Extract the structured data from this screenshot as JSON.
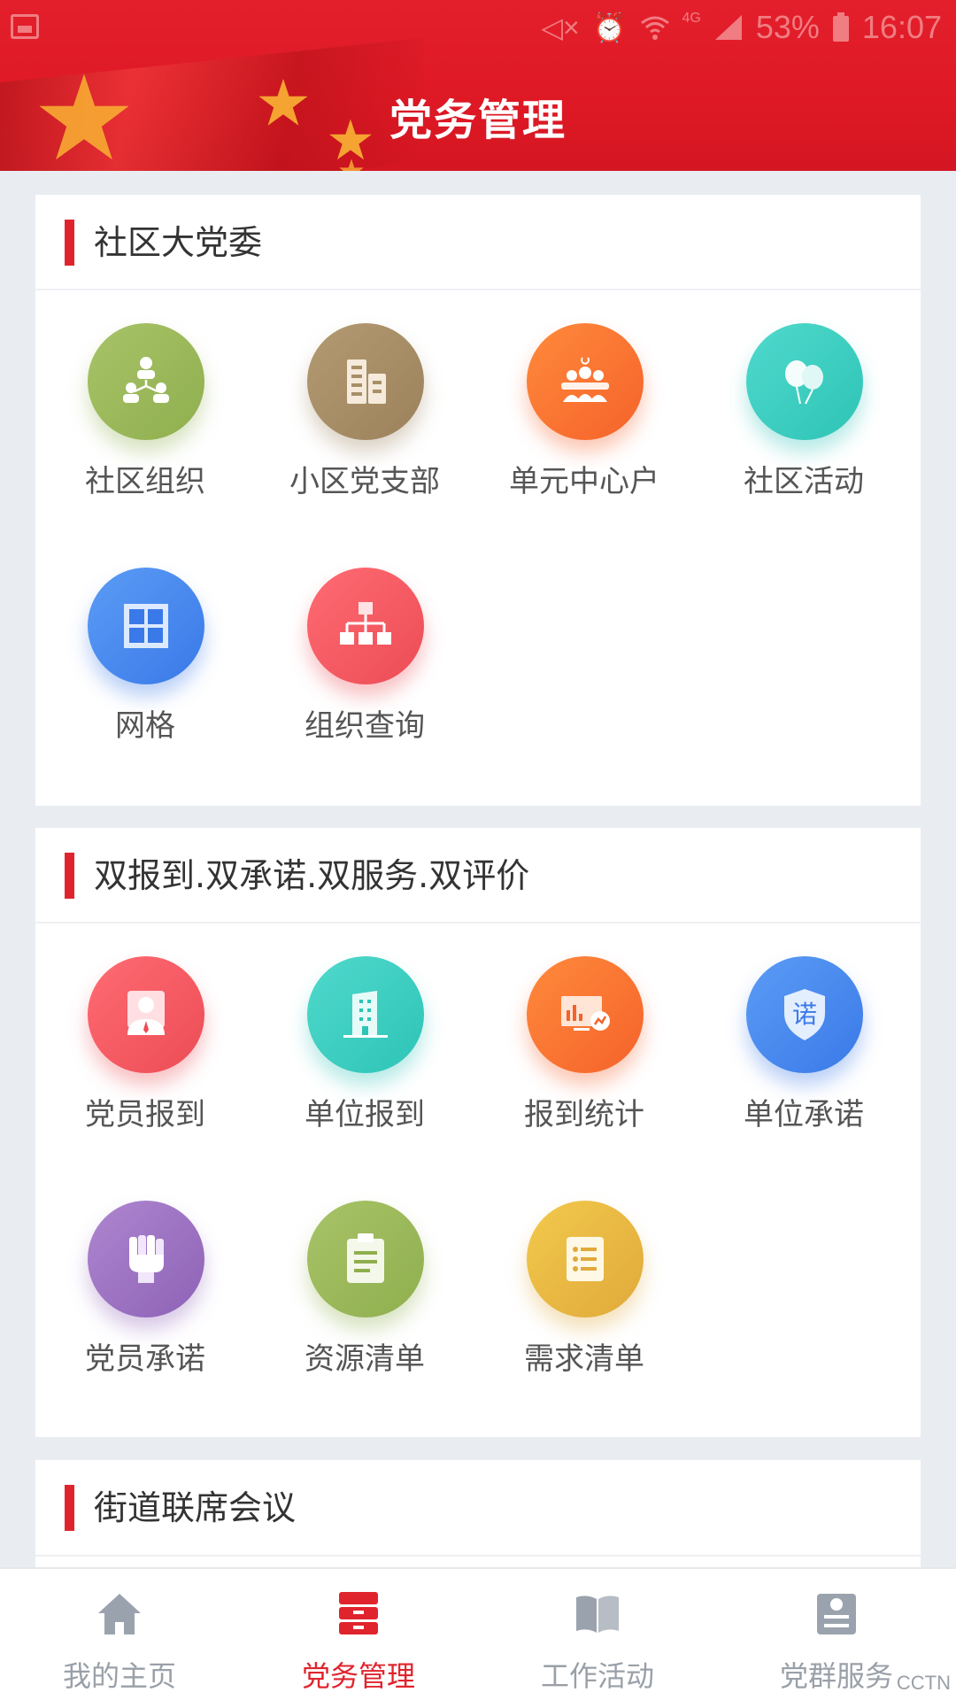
{
  "status_bar": {
    "battery": "53%",
    "time": "16:07",
    "icons": [
      "image-icon",
      "mute-icon",
      "alarm-icon",
      "wifi-icon",
      "4g-icon",
      "signal-icon",
      "battery-icon"
    ]
  },
  "header": {
    "title": "党务管理"
  },
  "sections": [
    {
      "title": "社区大党委",
      "items": [
        {
          "label": "社区组织",
          "icon": "org-people-icon",
          "color": "#9cb95c"
        },
        {
          "label": "小区党支部",
          "icon": "buildings-icon",
          "color": "#a88f68"
        },
        {
          "label": "单元中心户",
          "icon": "group-party-icon",
          "color": "#f87133"
        },
        {
          "label": "社区活动",
          "icon": "balloons-icon",
          "color": "#3fd0c3"
        },
        {
          "label": "网格",
          "icon": "grid-icon",
          "color": "#4a8aef"
        },
        {
          "label": "组织查询",
          "icon": "org-chart-icon",
          "color": "#f35b64"
        }
      ]
    },
    {
      "title": "双报到.双承诺.双服务.双评价",
      "items": [
        {
          "label": "党员报到",
          "icon": "member-icon",
          "color": "#f35b64"
        },
        {
          "label": "单位报到",
          "icon": "office-building-icon",
          "color": "#3fd0c3"
        },
        {
          "label": "报到统计",
          "icon": "stats-screen-icon",
          "color": "#f87133"
        },
        {
          "label": "单位承诺",
          "icon": "shield-promise-icon",
          "color": "#4a8aef"
        },
        {
          "label": "党员承诺",
          "icon": "fist-icon",
          "color": "#9e74c4"
        },
        {
          "label": "资源清单",
          "icon": "clipboard-icon",
          "color": "#9cb95c"
        },
        {
          "label": "需求清单",
          "icon": "list-icon",
          "color": "#e9b843"
        }
      ]
    },
    {
      "title": "街道联席会议",
      "items": []
    }
  ],
  "promise_glyph": "诺",
  "bottom_nav": [
    {
      "label": "我的主页",
      "icon": "home-icon",
      "active": false
    },
    {
      "label": "党务管理",
      "icon": "drawer-icon",
      "active": true
    },
    {
      "label": "工作活动",
      "icon": "book-icon",
      "active": false
    },
    {
      "label": "党群服务",
      "icon": "service-icon",
      "active": false
    }
  ],
  "watermark": "CCTN",
  "colors": {
    "primary_red": "#e0242d",
    "header_red": "#e41f2c",
    "background": "#e9edf1",
    "nav_inactive": "#9aa0a8"
  }
}
